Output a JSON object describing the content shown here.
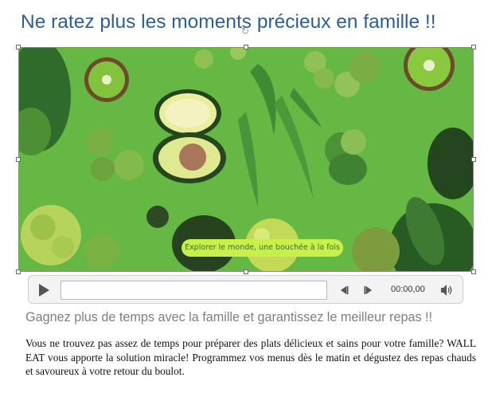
{
  "title": "Ne ratez plus les moments précieux en famille !!",
  "video": {
    "caption": "Explorer le monde, une bouchée à la fois"
  },
  "player": {
    "time": "00:00,00",
    "progress": 0,
    "icons": [
      "play-icon",
      "skip-back-icon",
      "skip-forward-icon",
      "volume-icon"
    ]
  },
  "subtitle": "Gagnez plus de temps avec la famille et garantissez le meilleur repas !!",
  "body": "Vous ne trouvez pas assez de temps pour préparer des plats délicieux et sains pour votre famille? WALL EAT vous apporte la solution miracle! Programmez vos menus dès le matin et dégustez des repas chauds et savoureux à votre retour du boulot.",
  "colors": {
    "title": "#2e5e93",
    "video_background": "#64b742",
    "caption_pill": "#c8ef4a",
    "subtitle": "#7f7f7f"
  }
}
